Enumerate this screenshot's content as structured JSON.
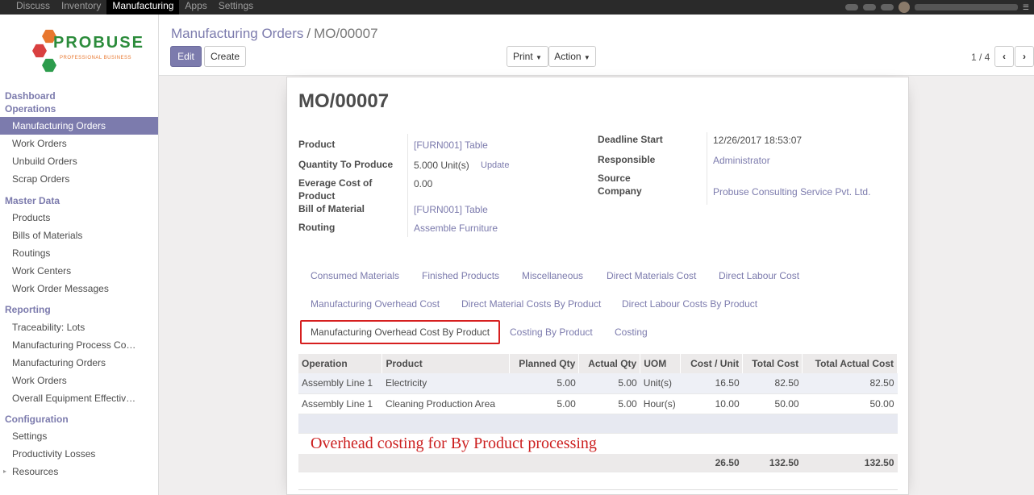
{
  "topbar": {
    "menu": [
      "Discuss",
      "Inventory",
      "Manufacturing",
      "Apps",
      "Settings"
    ],
    "active": "Manufacturing"
  },
  "brand": {
    "name": "PROBUSE",
    "tagline": "PROFESSIONAL BUSINESS",
    "colors": {
      "green": "#2c8c3c",
      "orange": "#e8772e",
      "red": "#d94040"
    }
  },
  "sidebar": {
    "dashboard": "Dashboard",
    "operations": {
      "title": "Operations",
      "items": [
        "Manufacturing Orders",
        "Work Orders",
        "Unbuild Orders",
        "Scrap Orders"
      ]
    },
    "master_data": {
      "title": "Master Data",
      "items": [
        "Products",
        "Bills of Materials",
        "Routings",
        "Work Centers",
        "Work Order Messages"
      ]
    },
    "reporting": {
      "title": "Reporting",
      "items": [
        "Traceability: Lots",
        "Manufacturing Process Co…",
        "Manufacturing Orders",
        "Work Orders",
        "Overall Equipment Effectiv…"
      ]
    },
    "configuration": {
      "title": "Configuration",
      "items": [
        "Settings",
        "Productivity Losses",
        "Resources"
      ]
    }
  },
  "control": {
    "breadcrumb_parent": "Manufacturing Orders",
    "breadcrumb_sep": "/",
    "breadcrumb_current": "MO/00007",
    "edit": "Edit",
    "create": "Create",
    "print": "Print",
    "action": "Action",
    "pager": "1 / 4"
  },
  "form": {
    "title": "MO/00007",
    "left": {
      "product_label": "Product",
      "product": "[FURN001] Table",
      "qty_label": "Quantity To Produce",
      "qty": "5.000",
      "uom": "Unit(s)",
      "update": "Update",
      "avg_cost_label": "Everage Cost of Product",
      "avg_cost": "0.00",
      "bom_label": "Bill of Material",
      "bom": "[FURN001] Table",
      "routing_label": "Routing",
      "routing": "Assemble Furniture"
    },
    "right": {
      "deadline_label": "Deadline Start",
      "deadline": "12/26/2017 18:53:07",
      "responsible_label": "Responsible",
      "responsible": "Administrator",
      "company_label": "Source Company",
      "company": "Probuse Consulting Service Pvt. Ltd."
    },
    "tabs": {
      "row1": [
        "Consumed Materials",
        "Finished Products",
        "Miscellaneous",
        "Direct Materials Cost",
        "Direct Labour Cost"
      ],
      "row2": [
        "Manufacturing Overhead Cost",
        "Direct Material Costs By Product",
        "Direct Labour Costs By Product"
      ],
      "row3": [
        "Manufacturing Overhead Cost By Product",
        "Costing By Product",
        "Costing"
      ],
      "active": "Manufacturing Overhead Cost By Product"
    },
    "table": {
      "headers": [
        "Operation",
        "Product",
        "Planned Qty",
        "Actual Qty",
        "UOM",
        "Cost / Unit",
        "Total Cost",
        "Total Actual Cost"
      ],
      "rows": [
        [
          "Assembly Line 1",
          "Electricity",
          "5.00",
          "5.00",
          "Unit(s)",
          "16.50",
          "82.50",
          "82.50"
        ],
        [
          "Assembly Line 1",
          "Cleaning Production Area",
          "5.00",
          "5.00",
          "Hour(s)",
          "10.00",
          "50.00",
          "50.00"
        ]
      ],
      "note": "Overhead costing for By Product processing",
      "totals": {
        "cost_unit": "26.50",
        "total_cost": "132.50",
        "total_actual": "132.50"
      }
    }
  },
  "colors": {
    "accent": "#7c7bad",
    "highlight": "#d61f1f"
  }
}
